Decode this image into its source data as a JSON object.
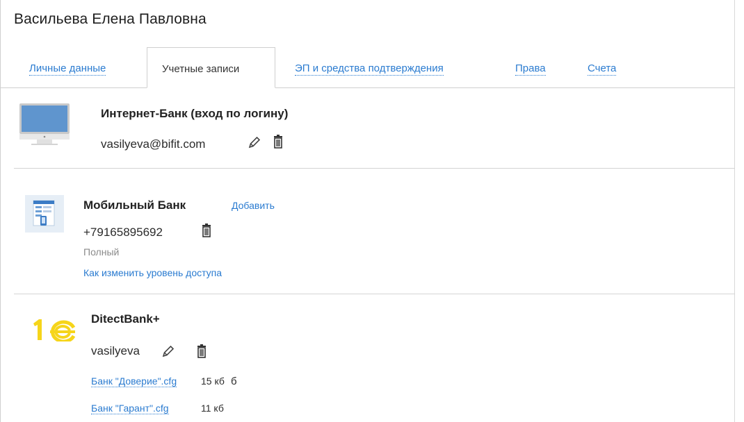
{
  "person_name": "Васильева Елена Павловна",
  "tabs": [
    {
      "label": "Личные данные",
      "active": false
    },
    {
      "label": "Учетные записи",
      "active": true
    },
    {
      "label": "ЭП и средства подтверждения",
      "active": false
    },
    {
      "label": "Права",
      "active": false
    },
    {
      "label": "Счета",
      "active": false
    }
  ],
  "accounts": {
    "internet_bank": {
      "title": "Интернет-Банк (вход по логину)",
      "login": "vasilyeva@bifit.com",
      "icons": [
        "monitor-icon",
        "pencil-icon",
        "trash-icon"
      ]
    },
    "mobile_bank": {
      "title": "Мобильный Банк",
      "add_label": "Добавить",
      "phone": "+79165895692",
      "access_level": "Полный",
      "change_access_link": "Как изменить уровень доступа",
      "icons": [
        "mobile-app-icon",
        "trash-icon"
      ]
    },
    "directbank": {
      "title": "DitectBank+",
      "login": "vasilyeva",
      "files": [
        {
          "name": "Банк \"Доверие\".cfg",
          "size": "15 кб",
          "extra": "б"
        },
        {
          "name": "Банк \"Гарант\".cfg",
          "size": "11 кб"
        }
      ],
      "icons": [
        "1c-logo-icon",
        "pencil-icon",
        "trash-icon"
      ]
    }
  },
  "colors": {
    "link": "#2a7bd0",
    "logo_1c": "#f6d51a",
    "border": "#cfcfcf"
  }
}
